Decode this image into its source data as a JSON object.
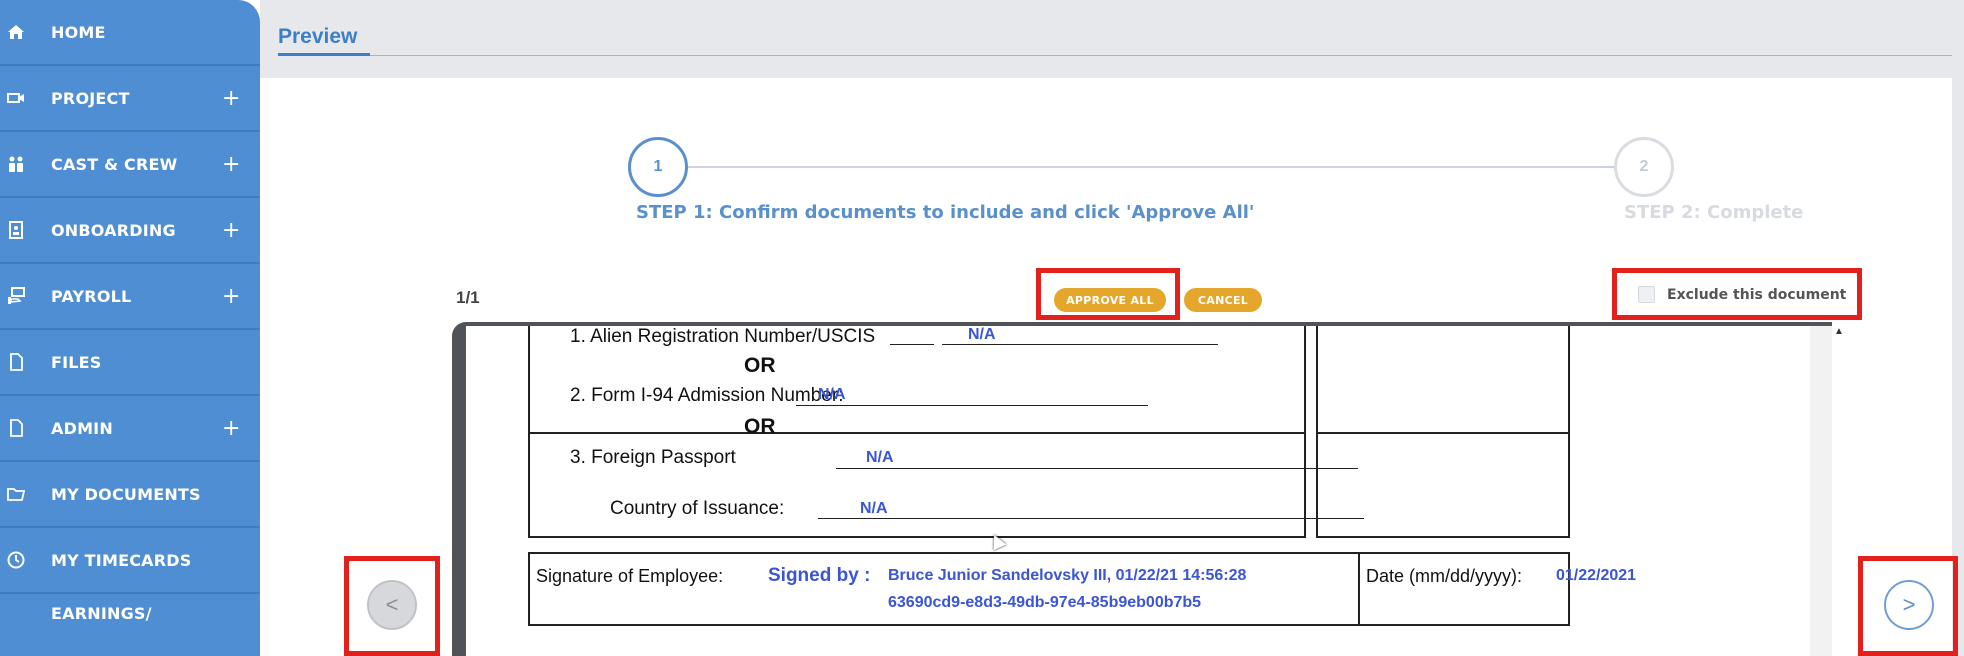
{
  "sidebar": {
    "items": [
      {
        "label": "HOME",
        "icon": "home-icon",
        "expandable": false
      },
      {
        "label": "PROJECT",
        "icon": "video-camera-icon",
        "expandable": true
      },
      {
        "label": "CAST & CREW",
        "icon": "people-icon",
        "expandable": true
      },
      {
        "label": "ONBOARDING",
        "icon": "badge-icon",
        "expandable": true
      },
      {
        "label": "PAYROLL",
        "icon": "money-hand-icon",
        "expandable": true
      },
      {
        "label": "FILES",
        "icon": "file-icon",
        "expandable": false
      },
      {
        "label": "ADMIN",
        "icon": "file-icon",
        "expandable": true
      },
      {
        "label": "MY DOCUMENTS",
        "icon": "folder-icon",
        "expandable": false
      },
      {
        "label": "MY TIMECARDS",
        "icon": "clock-icon",
        "expandable": false
      },
      {
        "label": "EARNINGS/",
        "icon": "",
        "expandable": false
      }
    ],
    "plus_symbol": "+"
  },
  "header": {
    "tab_label": "Preview"
  },
  "stepper": {
    "step1_number": "1",
    "step1_label": "STEP 1: Confirm documents to include and click 'Approve All'",
    "step2_number": "2",
    "step2_label": "STEP 2: Complete"
  },
  "toolbar": {
    "page_counter": "1/1",
    "approve_label": "APPROVE ALL",
    "cancel_label": "CANCEL",
    "exclude_label": "Exclude this document",
    "exclude_checked": false
  },
  "navigation": {
    "prev_symbol": "<",
    "next_symbol": ">"
  },
  "document": {
    "item1_label": "1. Alien Registration Number/USCIS",
    "item1_value": "N/A",
    "or_label": "OR",
    "item2_label": "2. Form I-94 Admission Number:",
    "item2_value": "N/A",
    "item3_label": "3. Foreign Passport",
    "item3_value": "N/A",
    "country_label": "Country of Issuance:",
    "country_value": "N/A",
    "signature_label": "Signature of Employee:",
    "signed_by_label": "Signed by :",
    "signed_by_value": "Bruce Junior  Sandelovsky  III, 01/22/21 14:56:28",
    "signature_hash": "63690cd9-e8d3-49db-97e4-85b9eb00b7b5",
    "date_label": "Date (mm/dd/yyyy):",
    "date_value": "01/22/2021"
  },
  "colors": {
    "sidebar_bg": "#4f8ed2",
    "accent_blue": "#5a90cc",
    "button_gold": "#e4a72b",
    "highlight_red": "#e3211c",
    "filled_value_blue": "#3a55d6"
  }
}
